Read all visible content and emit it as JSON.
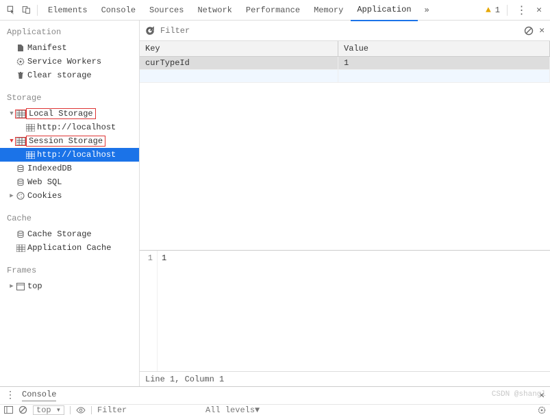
{
  "topbar": {
    "tabs": [
      "Elements",
      "Console",
      "Sources",
      "Network",
      "Performance",
      "Memory",
      "Application"
    ],
    "activeTab": "Application",
    "more": "»",
    "warningCount": "1"
  },
  "sidebar": {
    "sections": {
      "application": {
        "title": "Application",
        "items": [
          {
            "name": "manifest",
            "label": "Manifest",
            "icon": "file"
          },
          {
            "name": "service-workers",
            "label": "Service Workers",
            "icon": "gear"
          },
          {
            "name": "clear-storage",
            "label": "Clear storage",
            "icon": "trash"
          }
        ]
      },
      "storage": {
        "title": "Storage",
        "localStorage": {
          "label": "Local Storage",
          "child": "http://localhost"
        },
        "sessionStorage": {
          "label": "Session Storage",
          "child": "http://localhost"
        },
        "indexedDB": {
          "label": "IndexedDB"
        },
        "webSQL": {
          "label": "Web SQL"
        },
        "cookies": {
          "label": "Cookies"
        }
      },
      "cache": {
        "title": "Cache",
        "cacheStorage": {
          "label": "Cache Storage"
        },
        "applicationCache": {
          "label": "Application Cache"
        }
      },
      "frames": {
        "title": "Frames",
        "top": {
          "label": "top"
        }
      }
    }
  },
  "dataGrid": {
    "filterPlaceholder": "Filter",
    "columns": {
      "key": "Key",
      "value": "Value"
    },
    "rows": [
      {
        "key": "curTypeId",
        "value": "1"
      }
    ]
  },
  "editor": {
    "lineNumber": "1",
    "content": "1",
    "status": "Line 1, Column 1"
  },
  "console": {
    "label": "Console",
    "context": "top",
    "filterPlaceholder": "Filter",
    "levels": "All levels▼"
  },
  "watermark": "CSDN @shangl"
}
